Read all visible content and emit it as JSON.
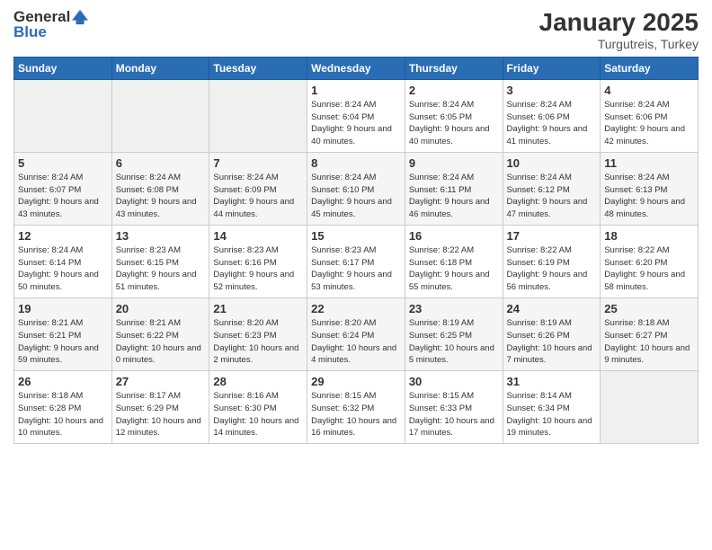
{
  "logo": {
    "general": "General",
    "blue": "Blue"
  },
  "title": "January 2025",
  "subtitle": "Turgutreis, Turkey",
  "days_of_week": [
    "Sunday",
    "Monday",
    "Tuesday",
    "Wednesday",
    "Thursday",
    "Friday",
    "Saturday"
  ],
  "weeks": [
    [
      {
        "day": "",
        "info": ""
      },
      {
        "day": "",
        "info": ""
      },
      {
        "day": "",
        "info": ""
      },
      {
        "day": "1",
        "info": "Sunrise: 8:24 AM\nSunset: 6:04 PM\nDaylight: 9 hours and 40 minutes."
      },
      {
        "day": "2",
        "info": "Sunrise: 8:24 AM\nSunset: 6:05 PM\nDaylight: 9 hours and 40 minutes."
      },
      {
        "day": "3",
        "info": "Sunrise: 8:24 AM\nSunset: 6:06 PM\nDaylight: 9 hours and 41 minutes."
      },
      {
        "day": "4",
        "info": "Sunrise: 8:24 AM\nSunset: 6:06 PM\nDaylight: 9 hours and 42 minutes."
      }
    ],
    [
      {
        "day": "5",
        "info": "Sunrise: 8:24 AM\nSunset: 6:07 PM\nDaylight: 9 hours and 43 minutes."
      },
      {
        "day": "6",
        "info": "Sunrise: 8:24 AM\nSunset: 6:08 PM\nDaylight: 9 hours and 43 minutes."
      },
      {
        "day": "7",
        "info": "Sunrise: 8:24 AM\nSunset: 6:09 PM\nDaylight: 9 hours and 44 minutes."
      },
      {
        "day": "8",
        "info": "Sunrise: 8:24 AM\nSunset: 6:10 PM\nDaylight: 9 hours and 45 minutes."
      },
      {
        "day": "9",
        "info": "Sunrise: 8:24 AM\nSunset: 6:11 PM\nDaylight: 9 hours and 46 minutes."
      },
      {
        "day": "10",
        "info": "Sunrise: 8:24 AM\nSunset: 6:12 PM\nDaylight: 9 hours and 47 minutes."
      },
      {
        "day": "11",
        "info": "Sunrise: 8:24 AM\nSunset: 6:13 PM\nDaylight: 9 hours and 48 minutes."
      }
    ],
    [
      {
        "day": "12",
        "info": "Sunrise: 8:24 AM\nSunset: 6:14 PM\nDaylight: 9 hours and 50 minutes."
      },
      {
        "day": "13",
        "info": "Sunrise: 8:23 AM\nSunset: 6:15 PM\nDaylight: 9 hours and 51 minutes."
      },
      {
        "day": "14",
        "info": "Sunrise: 8:23 AM\nSunset: 6:16 PM\nDaylight: 9 hours and 52 minutes."
      },
      {
        "day": "15",
        "info": "Sunrise: 8:23 AM\nSunset: 6:17 PM\nDaylight: 9 hours and 53 minutes."
      },
      {
        "day": "16",
        "info": "Sunrise: 8:22 AM\nSunset: 6:18 PM\nDaylight: 9 hours and 55 minutes."
      },
      {
        "day": "17",
        "info": "Sunrise: 8:22 AM\nSunset: 6:19 PM\nDaylight: 9 hours and 56 minutes."
      },
      {
        "day": "18",
        "info": "Sunrise: 8:22 AM\nSunset: 6:20 PM\nDaylight: 9 hours and 58 minutes."
      }
    ],
    [
      {
        "day": "19",
        "info": "Sunrise: 8:21 AM\nSunset: 6:21 PM\nDaylight: 9 hours and 59 minutes."
      },
      {
        "day": "20",
        "info": "Sunrise: 8:21 AM\nSunset: 6:22 PM\nDaylight: 10 hours and 0 minutes."
      },
      {
        "day": "21",
        "info": "Sunrise: 8:20 AM\nSunset: 6:23 PM\nDaylight: 10 hours and 2 minutes."
      },
      {
        "day": "22",
        "info": "Sunrise: 8:20 AM\nSunset: 6:24 PM\nDaylight: 10 hours and 4 minutes."
      },
      {
        "day": "23",
        "info": "Sunrise: 8:19 AM\nSunset: 6:25 PM\nDaylight: 10 hours and 5 minutes."
      },
      {
        "day": "24",
        "info": "Sunrise: 8:19 AM\nSunset: 6:26 PM\nDaylight: 10 hours and 7 minutes."
      },
      {
        "day": "25",
        "info": "Sunrise: 8:18 AM\nSunset: 6:27 PM\nDaylight: 10 hours and 9 minutes."
      }
    ],
    [
      {
        "day": "26",
        "info": "Sunrise: 8:18 AM\nSunset: 6:28 PM\nDaylight: 10 hours and 10 minutes."
      },
      {
        "day": "27",
        "info": "Sunrise: 8:17 AM\nSunset: 6:29 PM\nDaylight: 10 hours and 12 minutes."
      },
      {
        "day": "28",
        "info": "Sunrise: 8:16 AM\nSunset: 6:30 PM\nDaylight: 10 hours and 14 minutes."
      },
      {
        "day": "29",
        "info": "Sunrise: 8:15 AM\nSunset: 6:32 PM\nDaylight: 10 hours and 16 minutes."
      },
      {
        "day": "30",
        "info": "Sunrise: 8:15 AM\nSunset: 6:33 PM\nDaylight: 10 hours and 17 minutes."
      },
      {
        "day": "31",
        "info": "Sunrise: 8:14 AM\nSunset: 6:34 PM\nDaylight: 10 hours and 19 minutes."
      },
      {
        "day": "",
        "info": ""
      }
    ]
  ]
}
